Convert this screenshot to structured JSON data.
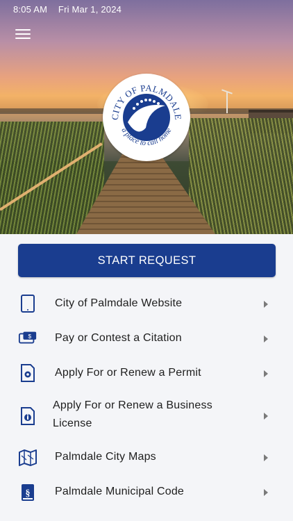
{
  "status_bar": {
    "time": "8:05 AM",
    "date": "Fri Mar 1, 2024"
  },
  "header": {
    "menu_icon": "hamburger-menu-icon"
  },
  "logo": {
    "top_text": "CITY OF PALMDALE",
    "bottom_text": "a place to call home",
    "accent_color": "#1a3d8f"
  },
  "primary_action": {
    "label": "START REQUEST",
    "color": "#1a3d8f"
  },
  "menu": [
    {
      "icon": "tablet-icon",
      "label": "City of Palmdale Website"
    },
    {
      "icon": "payment-card-icon",
      "label": "Pay or Contest a Citation"
    },
    {
      "icon": "document-gear-icon",
      "label": "Apply For or Renew a Permit"
    },
    {
      "icon": "document-info-icon",
      "label": "Apply For or Renew a Business License"
    },
    {
      "icon": "map-icon",
      "label": "Palmdale City Maps"
    },
    {
      "icon": "law-book-icon",
      "label": "Palmdale Municipal Code"
    }
  ]
}
